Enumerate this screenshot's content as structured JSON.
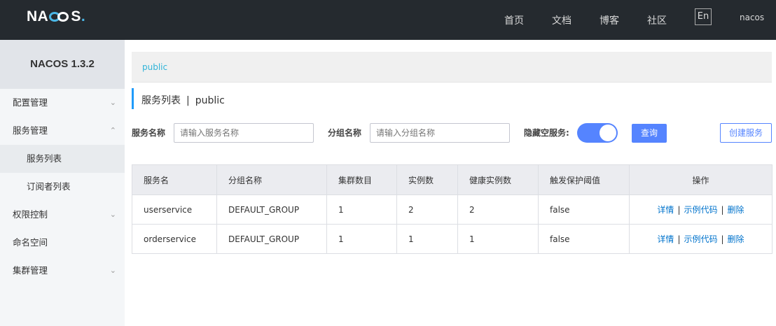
{
  "brand": {
    "logo_pre": "NA",
    "logo_post": "S",
    "logo_dot": "."
  },
  "topnav": {
    "home": "首页",
    "docs": "文档",
    "blog": "博客",
    "community": "社区",
    "lang": "En",
    "user": "nacos"
  },
  "sidebar": {
    "title": "NACOS 1.3.2",
    "items": [
      {
        "label": "配置管理",
        "chevron": "chevron-down-icon"
      },
      {
        "label": "服务管理",
        "chevron": "chevron-up-icon"
      },
      {
        "label": "服务列表"
      },
      {
        "label": "订阅者列表"
      },
      {
        "label": "权限控制",
        "chevron": "chevron-down-icon"
      },
      {
        "label": "命名空间"
      },
      {
        "label": "集群管理",
        "chevron": "chevron-down-icon"
      }
    ]
  },
  "breadcrumb": {
    "namespace": "public"
  },
  "title": {
    "text": "服务列表",
    "separator": "|",
    "namespace": "public"
  },
  "filters": {
    "service_label": "服务名称",
    "service_placeholder": "请输入服务名称",
    "group_label": "分组名称",
    "group_placeholder": "请输入分组名称",
    "hide_empty_label": "隐藏空服务:",
    "hide_empty_on": true,
    "query": "查询",
    "create": "创建服务"
  },
  "table": {
    "columns": [
      "服务名",
      "分组名称",
      "集群数目",
      "实例数",
      "健康实例数",
      "触发保护阈值",
      "操作"
    ],
    "rows": [
      {
        "name": "userservice",
        "group": "DEFAULT_GROUP",
        "clusters": "1",
        "instances": "2",
        "healthy": "2",
        "threshold": "false"
      },
      {
        "name": "orderservice",
        "group": "DEFAULT_GROUP",
        "clusters": "1",
        "instances": "1",
        "healthy": "1",
        "threshold": "false"
      }
    ],
    "actions": {
      "detail": "详情",
      "sample": "示例代码",
      "delete": "删除",
      "sep": "|"
    }
  },
  "colors": {
    "topbar": "#252a2f",
    "primary": "#5584ff",
    "link": "#0073cc",
    "accent": "#2fb4d8"
  }
}
